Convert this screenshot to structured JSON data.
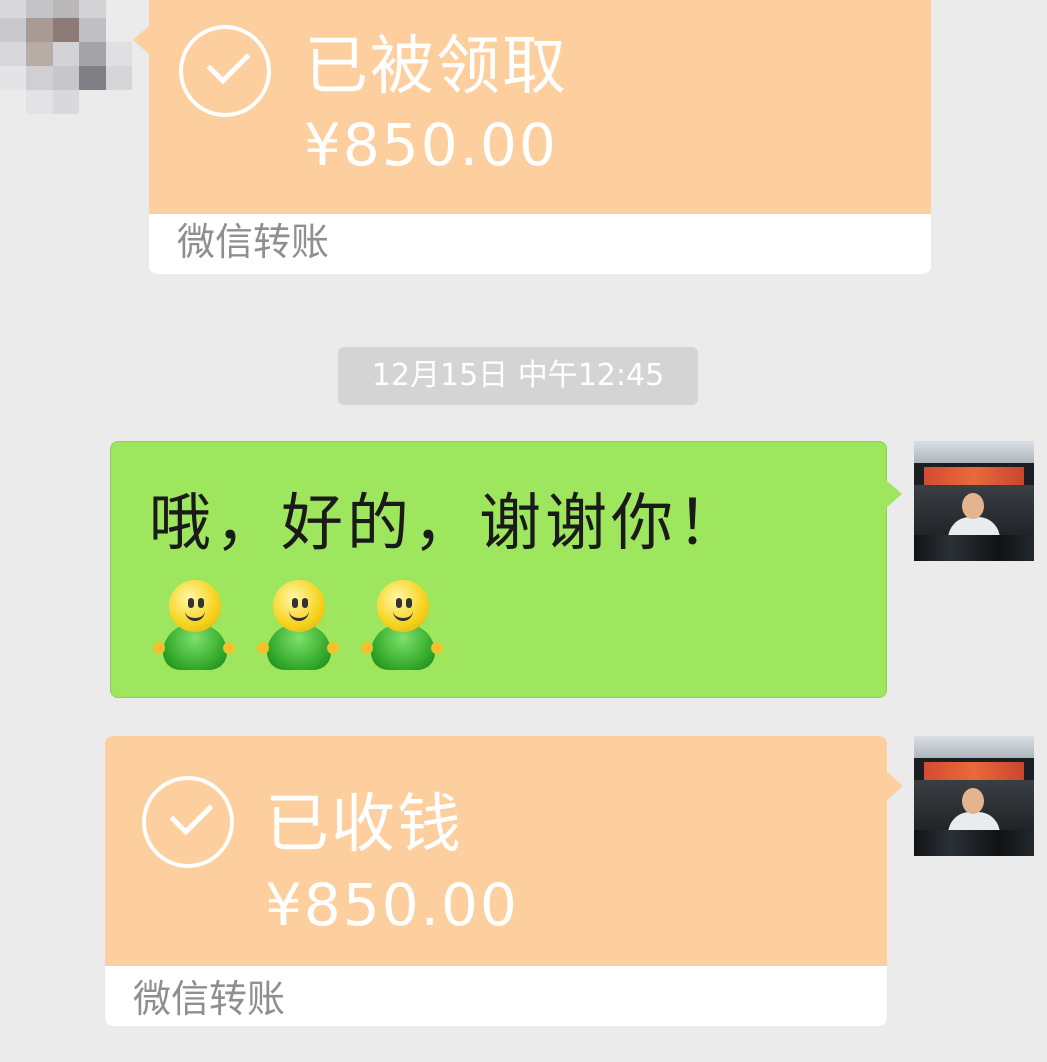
{
  "messages": {
    "transfer_received": {
      "status": "已被领取",
      "amount": "¥850.00",
      "label": "微信转账"
    },
    "timestamp": "12月15日 中午12:45",
    "text_message": {
      "text": "哦，好的，谢谢你！",
      "emoji_count": 3,
      "emoji_icon": "smiley-figure-icon"
    },
    "transfer_sent": {
      "status": "已收钱",
      "amount": "¥850.00",
      "label": "微信转账"
    }
  },
  "colors": {
    "background": "#ebebeb",
    "transfer_card": "#fdcf9e",
    "text_bubble": "#9fe65f",
    "timestamp_pill": "#d4d4d4"
  }
}
